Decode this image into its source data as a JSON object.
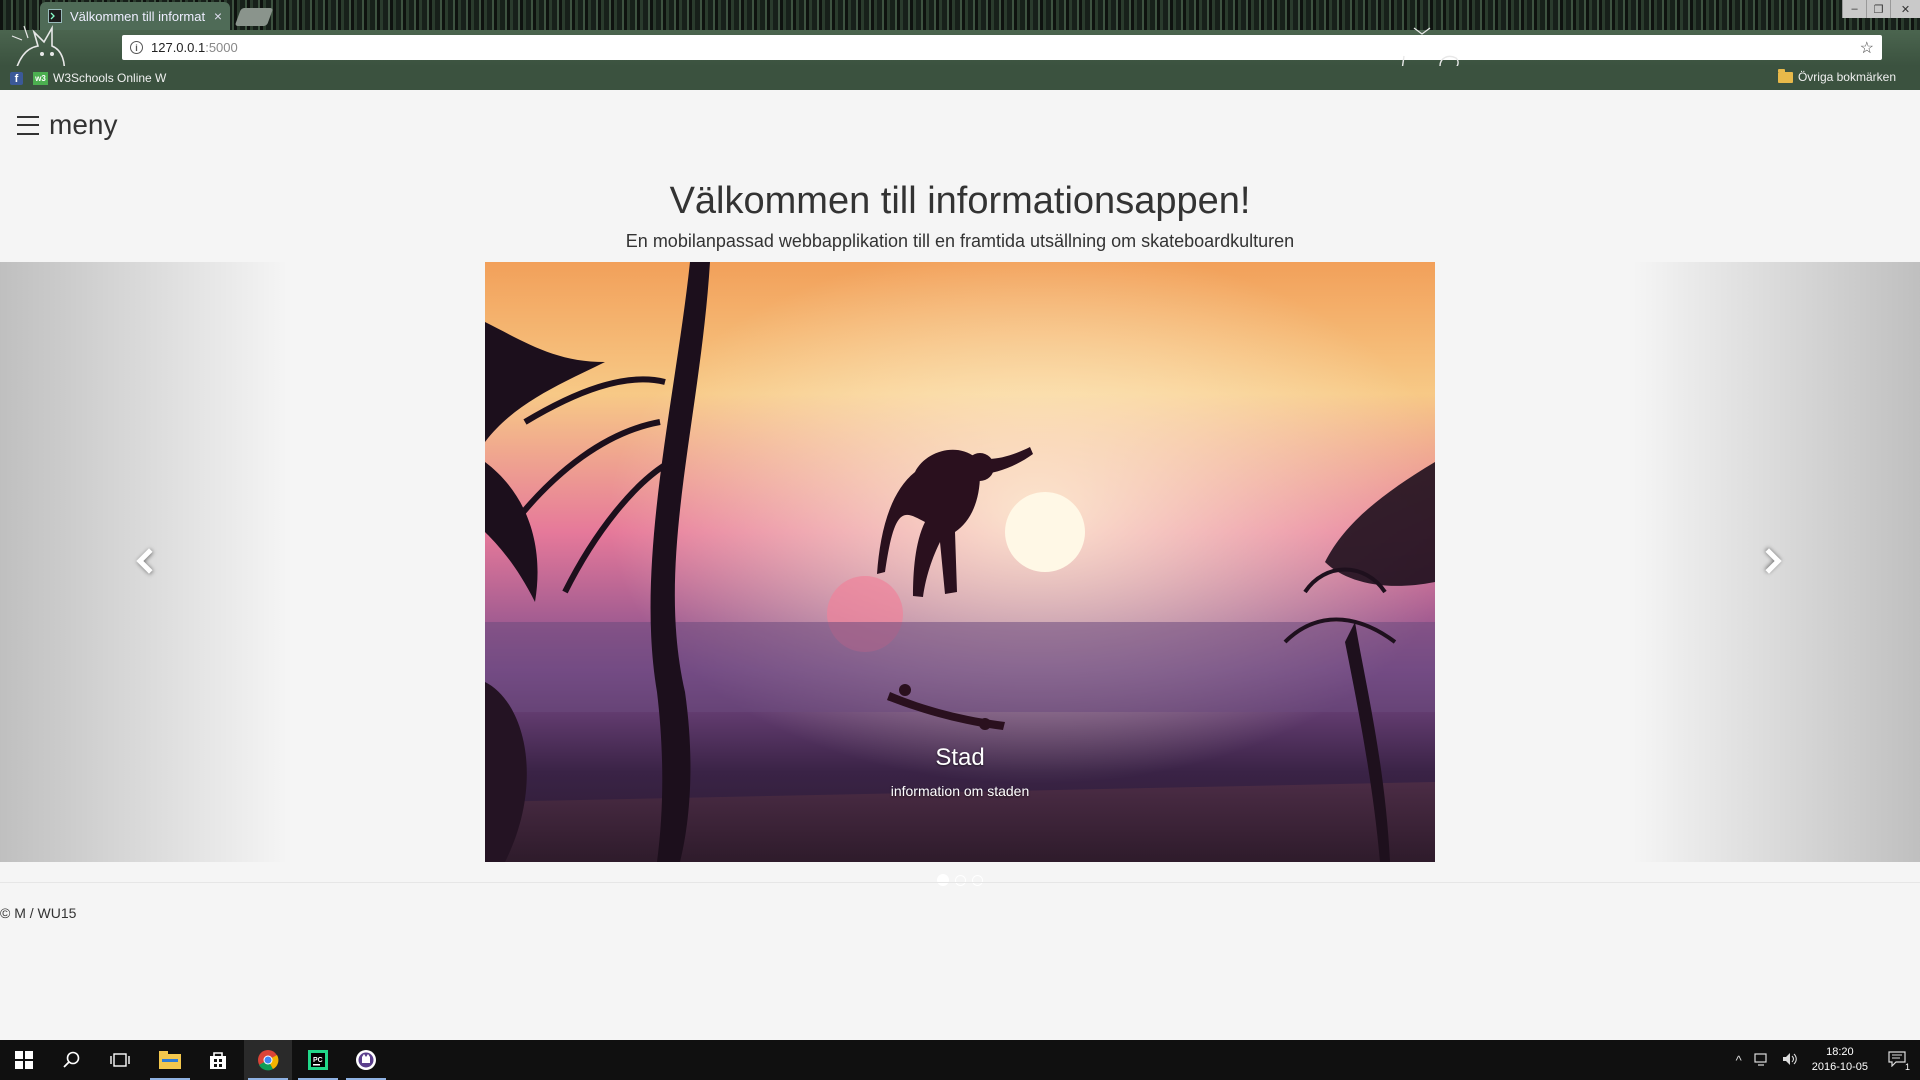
{
  "browser": {
    "tab_title": "Välkommen till informati",
    "tab_close": "×",
    "url_host": "127.0.0.1",
    "url_port": ":5000",
    "window_controls": [
      "minimize",
      "restore",
      "close"
    ],
    "bookmarks": [
      {
        "icon": "facebook-icon",
        "label": ""
      },
      {
        "icon": "w3schools-icon",
        "label": "W3Schools Online W"
      }
    ],
    "other_bookmarks": "Övriga bokmärken"
  },
  "page": {
    "menu_label": "meny",
    "title": "Välkommen till informationsappen!",
    "subtitle": "En mobilanpassad webbapplikation till en framtida utsällning om skateboardkulturen",
    "carousel": {
      "active_index": 0,
      "slide_count": 3,
      "slides": [
        {
          "title": "Stad",
          "text": "information om staden"
        }
      ]
    },
    "footer": "© M / WU15"
  },
  "taskbar": {
    "apps": [
      "start-icon",
      "search-icon",
      "task-view-icon",
      "file-explorer-icon",
      "store-icon",
      "chrome-icon",
      "pycharm-icon",
      "app-icon"
    ],
    "active_app": "chrome-icon",
    "clock_time": "18:20",
    "clock_date": "2016-10-05",
    "notification_count": "1"
  },
  "colors": {
    "page_bg": "#f5f5f5",
    "tab_active": "#4f6b57",
    "taskbar": "#101010",
    "accent_underline": "#8fb2e3"
  }
}
